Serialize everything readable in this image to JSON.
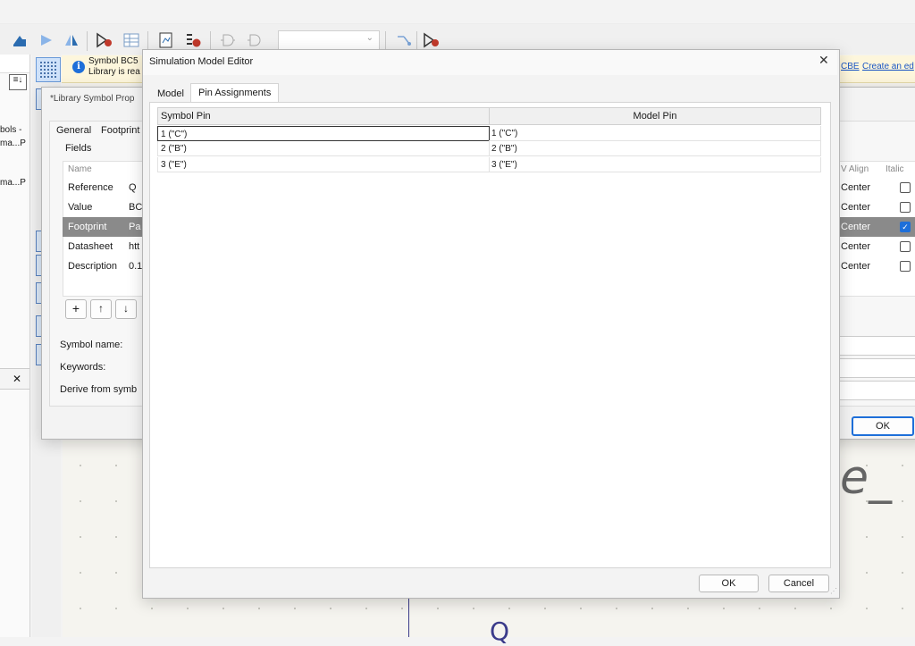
{
  "toolbar": {
    "icons": [
      "save-icon",
      "run-icon",
      "mirror-icon",
      "symbol-checker-icon",
      "table-icon",
      "datasheet-icon",
      "erc-icon",
      "gate-icon",
      "gate2-icon",
      "pin-icon",
      "symbol-icon"
    ],
    "unit_select": ""
  },
  "infobar": {
    "line1": "Symbol BC5",
    "line2": "Library is rea",
    "link1": "CBE",
    "link2": "Create an ed"
  },
  "left_panel": {
    "item1": "bols -",
    "item2": "ma...P",
    "item3": "ma...P"
  },
  "symbol_props": {
    "title": "*Library Symbol Prop",
    "tabs": [
      "General",
      "Footprint"
    ],
    "fields_label": "Fields",
    "columns": {
      "name": "Name",
      "v_align": "V Align",
      "italic": "Italic"
    },
    "rows": [
      {
        "name": "Reference",
        "value": "Q",
        "v_align": "Center",
        "italic": false
      },
      {
        "name": "Value",
        "value": "BC",
        "v_align": "Center",
        "italic": false
      },
      {
        "name": "Footprint",
        "value": "Pa",
        "v_align": "Center",
        "italic": true
      },
      {
        "name": "Datasheet",
        "value": "htt",
        "v_align": "Center",
        "italic": false
      },
      {
        "name": "Description",
        "value": "0.1.",
        "v_align": "Center",
        "italic": false
      }
    ],
    "symbol_name_label": "Symbol name:",
    "keywords_label": "Keywords:",
    "derive_label": "Derive from symb",
    "ok": "OK"
  },
  "sim_editor": {
    "title": "Simulation Model Editor",
    "tabs": [
      "Model",
      "Pin Assignments"
    ],
    "active_tab": "Pin Assignments",
    "columns": [
      "Symbol Pin",
      "Model Pin"
    ],
    "rows": [
      {
        "symbol_pin": "1 (\"C\")",
        "model_pin": "1 (\"C\")"
      },
      {
        "symbol_pin": "2 (\"B\")",
        "model_pin": "2 (\"B\")"
      },
      {
        "symbol_pin": "3 (\"E\")",
        "model_pin": "3 (\"E\")"
      }
    ],
    "ok": "OK",
    "cancel": "Cancel"
  },
  "canvas": {
    "text_fragment": "e_",
    "q_fragment": "Q"
  },
  "colors": {
    "accent": "#1e6fd9",
    "selected_row": "#8a8a8a",
    "infobar": "#fdf6dc"
  }
}
